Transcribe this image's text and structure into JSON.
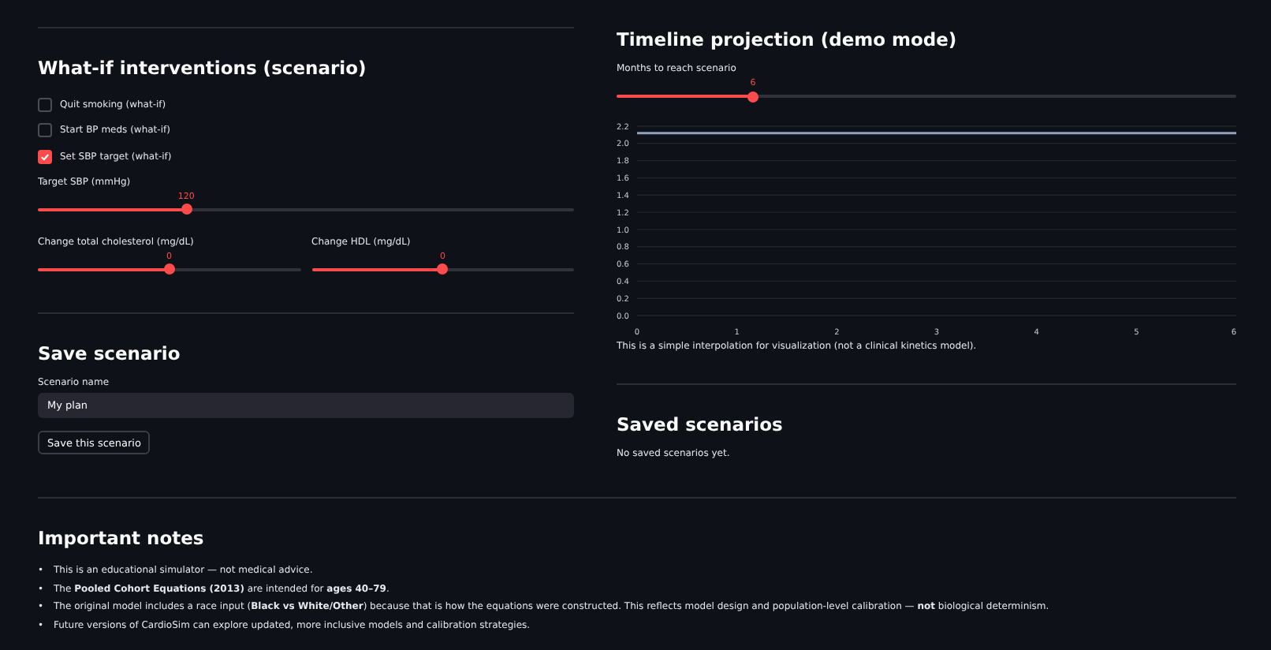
{
  "interventions": {
    "title": "What-if interventions (scenario)",
    "checkboxes": [
      {
        "label": "Quit smoking (what-if)",
        "checked": false
      },
      {
        "label": "Start BP meds (what-if)",
        "checked": false
      },
      {
        "label": "Set SBP target (what-if)",
        "checked": true
      }
    ],
    "target_slider": {
      "label": "Target SBP (mmHg)",
      "value": "120",
      "level": 0.277
    },
    "sliders": [
      {
        "label": "Change total cholesterol (mg/dL)",
        "value": "0",
        "level": 0.5
      },
      {
        "label": "Change HDL (mg/dL)",
        "value": "0",
        "level": 0.5
      }
    ]
  },
  "save": {
    "title": "Save scenario",
    "field_label": "Scenario name",
    "field_value": "My plan",
    "button": "Save this scenario"
  },
  "timeline": {
    "title": "Timeline projection (demo mode)",
    "slider": {
      "label": "Months to reach scenario",
      "value": "6",
      "level": 0.22
    },
    "chart_data": {
      "type": "line",
      "x": [
        0,
        6
      ],
      "series": [
        {
          "color": "#8fa3bf",
          "values": [
            2.12,
            2.12
          ]
        }
      ],
      "grid": true,
      "xlim": [
        0,
        6
      ],
      "ylim": [
        0,
        2.2
      ],
      "xticks": [
        0,
        1,
        2,
        3,
        4,
        5,
        6
      ],
      "yticks": [
        {
          "value": 0,
          "label": "0.0"
        },
        {
          "value": 0.2,
          "label": "0.2"
        },
        {
          "value": 0.4,
          "label": "0.4"
        },
        {
          "value": 0.6,
          "label": "0.6"
        },
        {
          "value": 0.8,
          "label": "0.8"
        },
        {
          "value": 1,
          "label": "1.0"
        },
        {
          "value": 1.2,
          "label": "1.2"
        },
        {
          "value": 1.4,
          "label": "1.4"
        },
        {
          "value": 1.6,
          "label": "1.6"
        },
        {
          "value": 1.8,
          "label": "1.8"
        },
        {
          "value": 2,
          "label": "2.0"
        },
        {
          "value": 2.2,
          "label": "2.2"
        }
      ]
    },
    "caption": "This is a simple interpolation for visualization (not a clinical kinetics model)."
  },
  "saved": {
    "title": "Saved scenarios",
    "empty_text": "No saved scenarios yet."
  },
  "notes": {
    "title": "Important notes",
    "items": [
      {
        "bullet": "•",
        "text": "This is an educational simulator — not medical advice."
      },
      {
        "bullet": "•",
        "text": "The **Pooled Cohort Equations (2013)** are intended for **ages 40–79**."
      },
      {
        "bullet": "•",
        "text": "The original model includes a race input (**Black vs White/Other**) because that is how the equations were constructed. This reflects model design and population-level calibration — **not** biological determinism."
      },
      {
        "bullet": "•",
        "text": "Future versions of CardioSim can explore updated, more inclusive models and calibration strategies."
      }
    ]
  }
}
